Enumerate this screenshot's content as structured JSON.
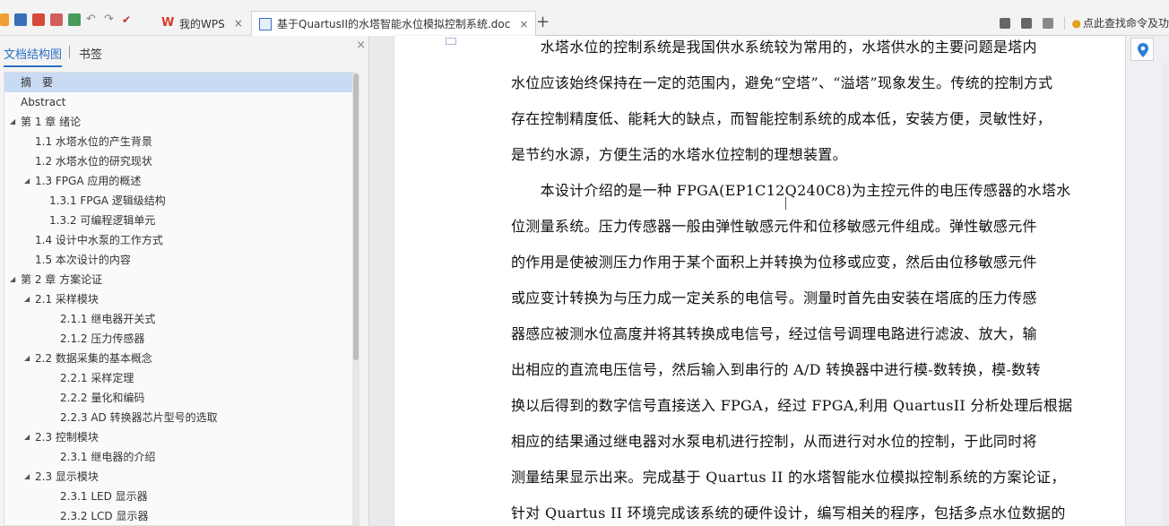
{
  "tabs": {
    "wps": {
      "label": "我的WPS",
      "close": "×"
    },
    "doc": {
      "label": "基于QuartusII的水塔智能水位模拟控制系统.doc",
      "close": "×"
    },
    "new_tab": "+"
  },
  "topright": {
    "search_hint": "点此查找命令及功"
  },
  "nav": {
    "tab_outline": "文档结构图",
    "tab_bookmarks": "书签",
    "close": "×",
    "items": [
      {
        "label": "摘　要",
        "expand": ""
      },
      {
        "label": "Abstract",
        "expand": ""
      },
      {
        "label": "第 1 章  绪论",
        "expand": "◢"
      },
      {
        "label": "1.1 水塔水位的产生背景",
        "expand": ""
      },
      {
        "label": "1.2 水塔水位的研究现状",
        "expand": ""
      },
      {
        "label": "1.3 FPGA 应用的概述",
        "expand": "◢"
      },
      {
        "label": "1.3.1 FPGA 逻辑级结构",
        "expand": ""
      },
      {
        "label": "1.3.2 可编程逻辑单元",
        "expand": ""
      },
      {
        "label": "1.4 设计中水泵的工作方式",
        "expand": ""
      },
      {
        "label": "1.5 本次设计的内容",
        "expand": ""
      },
      {
        "label": "第 2 章  方案论证",
        "expand": "◢"
      },
      {
        "label": "2.1  采样模块",
        "expand": "◢"
      },
      {
        "label": "2.1.1  继电器开关式",
        "expand": ""
      },
      {
        "label": "2.1.2  压力传感器",
        "expand": ""
      },
      {
        "label": "2.2  数据采集的基本概念",
        "expand": "◢"
      },
      {
        "label": "2.2.1  采样定理",
        "expand": ""
      },
      {
        "label": "2.2.2  量化和编码",
        "expand": ""
      },
      {
        "label": "2.2.3 AD 转换器芯片型号的选取",
        "expand": ""
      },
      {
        "label": "2.3  控制模块",
        "expand": "◢"
      },
      {
        "label": "2.3.1  继电器的介绍",
        "expand": ""
      },
      {
        "label": "2.3  显示模块",
        "expand": "◢"
      },
      {
        "label": "2.3.1 LED 显示器",
        "expand": ""
      },
      {
        "label": "2.3.2 LCD 显示器",
        "expand": ""
      }
    ]
  },
  "document": {
    "lines": [
      "　　水塔水位的控制系统是我国供水系统较为常用的，水塔供水的主要问题是塔内",
      "水位应该始终保持在一定的范围内，避免“空塔”、“溢塔”现象发生。传统的控制方式",
      "存在控制精度低、能耗大的缺点，而智能控制系统的成本低，安装方便，灵敏性好，",
      "是节约水源，方便生活的水塔水位控制的理想装置。",
      "　　本设计介绍的是一种 FPGA(EP1C12Q240C8)为主控元件的电压传感器的水塔水",
      "位测量系统。压力传感器一般由弹性敏感元件和位移敏感元件组成。弹性敏感元件",
      "的作用是使被测压力作用于某个面积上并转换为位移或应变，然后由位移敏感元件",
      "或应变计转换为与压力成一定关系的电信号。测量时首先由安装在塔底的压力传感",
      "器感应被测水位高度并将其转换成电信号，经过信号调理电路进行滤波、放大，输",
      "出相应的直流电压信号，然后输入到串行的 A/D 转换器中进行模-数转换，模-数转",
      "换以后得到的数字信号直接送入 FPGA，经过 FPGA,利用 QuartusII 分析处理后根据",
      "相应的结果通过继电器对水泵电机进行控制，从而进行对水位的控制，于此同时将",
      "测量结果显示出来。完成基于 Quartus II 的水塔智能水位模拟控制系统的方案论证，",
      "针对 Quartus II 环境完成该系统的硬件设计，编写相关的程序，包括多点水位数据的"
    ]
  }
}
